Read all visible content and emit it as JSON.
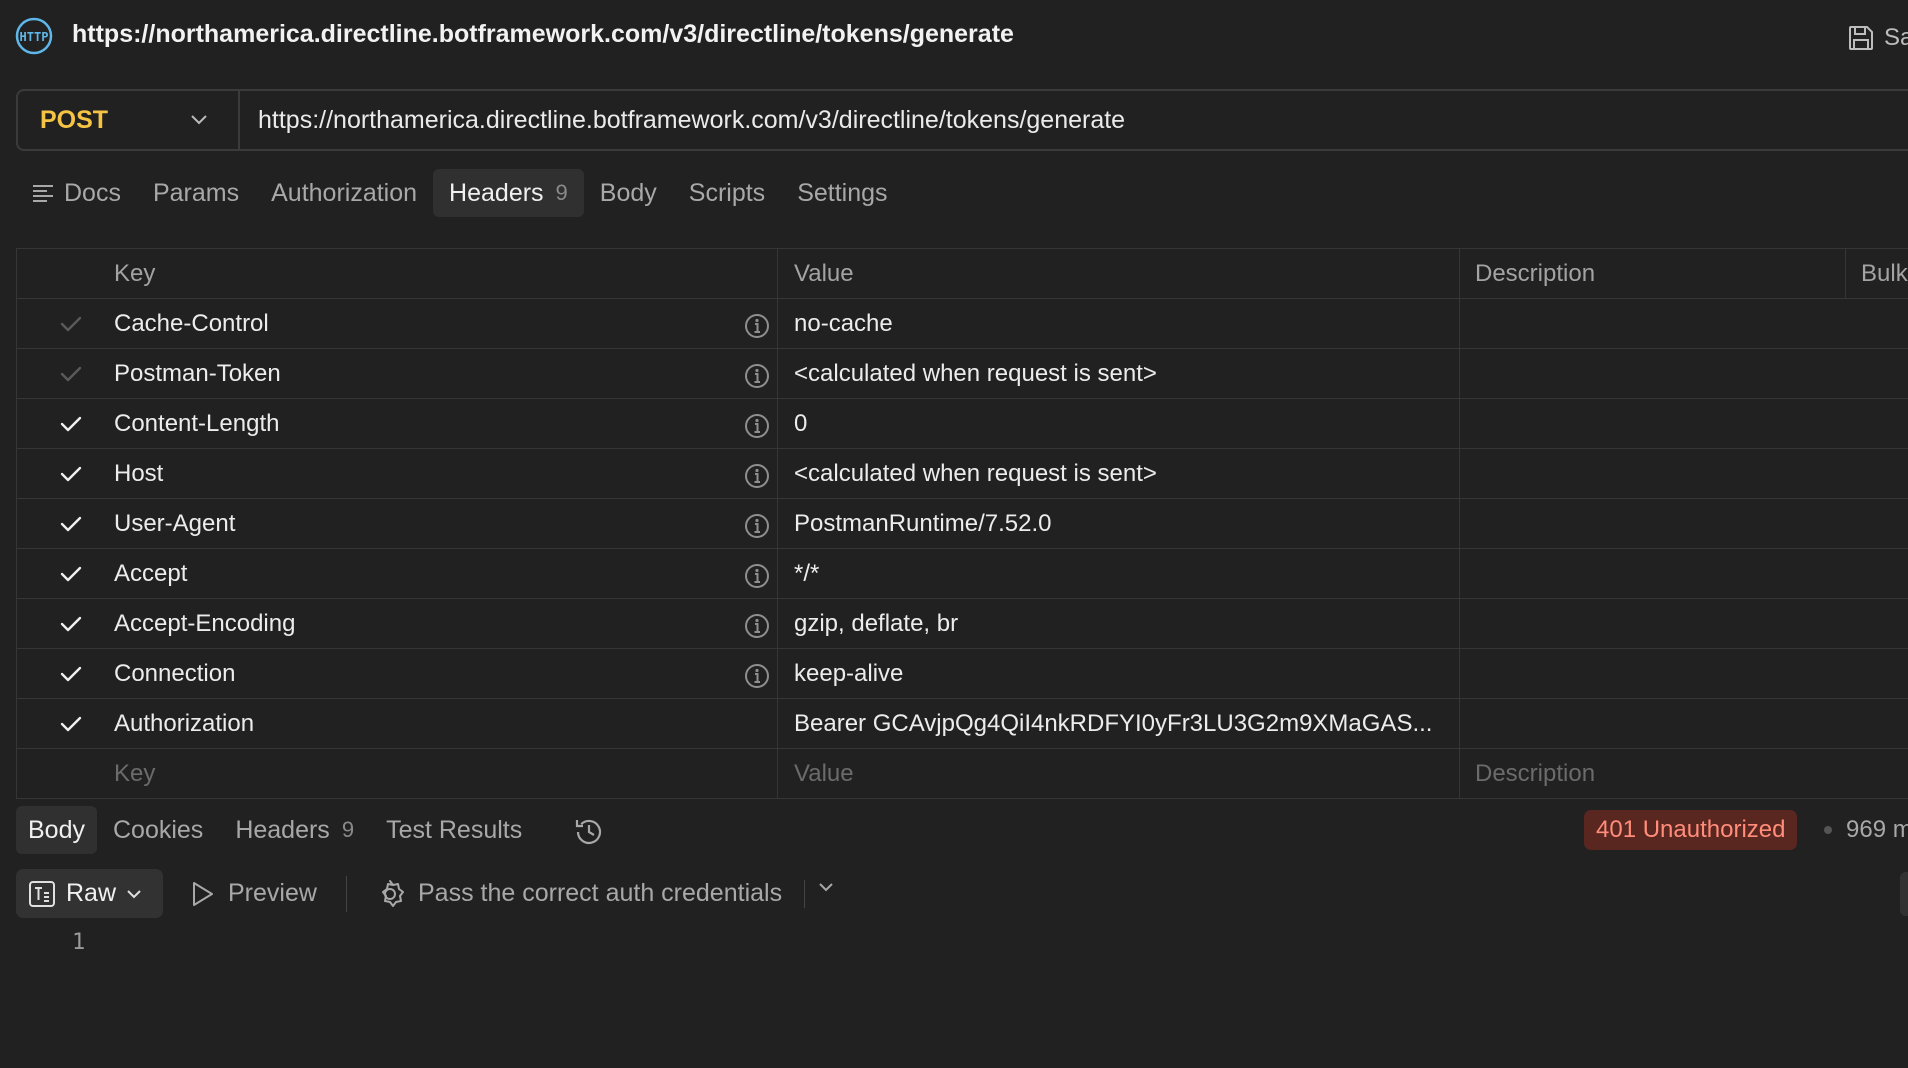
{
  "title": {
    "url": "https://northamerica.directline.botframework.com/v3/directline/tokens/generate",
    "save_label": "Sa",
    "icons": {
      "request": "http-icon",
      "save": "save-icon"
    }
  },
  "request": {
    "method": "POST",
    "url": "https://northamerica.directline.botframework.com/v3/directline/tokens/generate"
  },
  "request_tabs": [
    {
      "label": "Docs",
      "icon": "docs-icon"
    },
    {
      "label": "Params"
    },
    {
      "label": "Authorization"
    },
    {
      "label": "Headers",
      "count": "9",
      "active": true
    },
    {
      "label": "Body"
    },
    {
      "label": "Scripts"
    },
    {
      "label": "Settings"
    }
  ],
  "headers_table": {
    "columns": {
      "key": "Key",
      "value": "Value",
      "description": "Description",
      "bulk": "Bulk"
    },
    "rows": [
      {
        "checked": "dim",
        "key": "Cache-Control",
        "value": "no-cache",
        "info": true
      },
      {
        "checked": "dim",
        "key": "Postman-Token",
        "value": "<calculated when request is sent>",
        "info": true
      },
      {
        "checked": "on",
        "key": "Content-Length",
        "value": "0",
        "info": true
      },
      {
        "checked": "on",
        "key": "Host",
        "value": "<calculated when request is sent>",
        "info": true
      },
      {
        "checked": "on",
        "key": "User-Agent",
        "value": "PostmanRuntime/7.52.0",
        "info": true
      },
      {
        "checked": "on",
        "key": "Accept",
        "value": "*/*",
        "info": true
      },
      {
        "checked": "on",
        "key": "Accept-Encoding",
        "value": "gzip, deflate, br",
        "info": true
      },
      {
        "checked": "on",
        "key": "Connection",
        "value": "keep-alive",
        "info": true
      },
      {
        "checked": "on",
        "key": "Authorization",
        "value": "Bearer GCAvjpQg4QiI4nkRDFYI0yFr3LU3G2m9XMaGAS...",
        "info": false
      }
    ],
    "placeholders": {
      "key": "Key",
      "value": "Value",
      "description": "Description"
    }
  },
  "response": {
    "tabs": [
      {
        "label": "Body",
        "active": true
      },
      {
        "label": "Cookies"
      },
      {
        "label": "Headers",
        "count": "9"
      },
      {
        "label": "Test Results"
      }
    ],
    "status": "401 Unauthorized",
    "time": "969 m",
    "status_color": "#ff8d7a",
    "toolbar": {
      "format": "Raw",
      "preview": "Preview",
      "hint": "Pass the correct auth credentials"
    },
    "line_number": "1"
  }
}
